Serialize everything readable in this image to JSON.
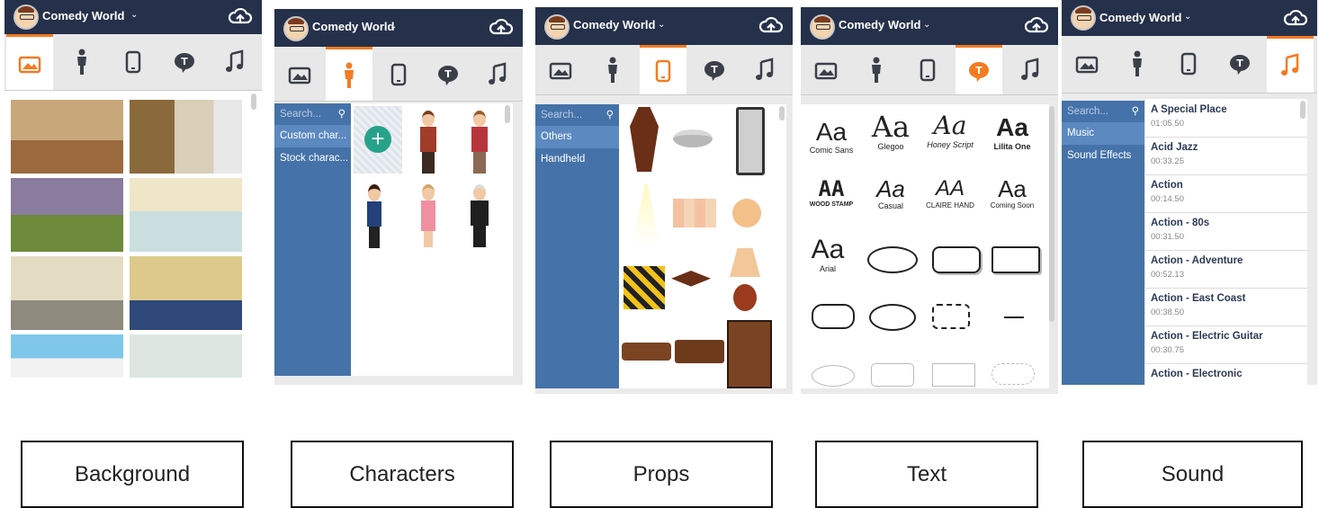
{
  "app": {
    "title": "Comedy World"
  },
  "labels": [
    "Background",
    "Characters",
    "Props",
    "Text",
    "Sound"
  ],
  "characters": {
    "search": "Search...",
    "categories": [
      "Custom char...",
      "Stock charac..."
    ]
  },
  "props": {
    "search": "Search...",
    "categories": [
      "Others",
      "Handheld"
    ]
  },
  "text": {
    "fonts": [
      {
        "big": "Aa",
        "name": "Comic Sans"
      },
      {
        "big": "Aa",
        "name": "Glegoo"
      },
      {
        "big": "Aa",
        "name": "Honey Script"
      },
      {
        "big": "Aa",
        "name": "Lilita One"
      },
      {
        "big": "AA",
        "name": "WOOD STAMP"
      },
      {
        "big": "Aa",
        "name": "Casual"
      },
      {
        "big": "AA",
        "name": "CLAIRE HAND"
      },
      {
        "big": "Aa",
        "name": "Coming Soon"
      },
      {
        "big": "Aa",
        "name": "Arial"
      }
    ]
  },
  "sound": {
    "search": "Search...",
    "categories": [
      "Music",
      "Sound Effects"
    ],
    "tracks": [
      {
        "name": "A Special Place",
        "time": "01:05.50"
      },
      {
        "name": "Acid Jazz",
        "time": "00:33.25"
      },
      {
        "name": "Action",
        "time": "00:14.50"
      },
      {
        "name": "Action - 80s",
        "time": "00:31.50"
      },
      {
        "name": "Action - Adventure",
        "time": "00:52.13"
      },
      {
        "name": "Action - East Coast",
        "time": "00:38.50"
      },
      {
        "name": "Action - Electric Guitar",
        "time": "00:30.75"
      },
      {
        "name": "Action - Electronic",
        "time": ""
      }
    ]
  },
  "colors": {
    "accent": "#f47b20",
    "topbar": "#25304a",
    "sidebar": "#4572a8"
  }
}
